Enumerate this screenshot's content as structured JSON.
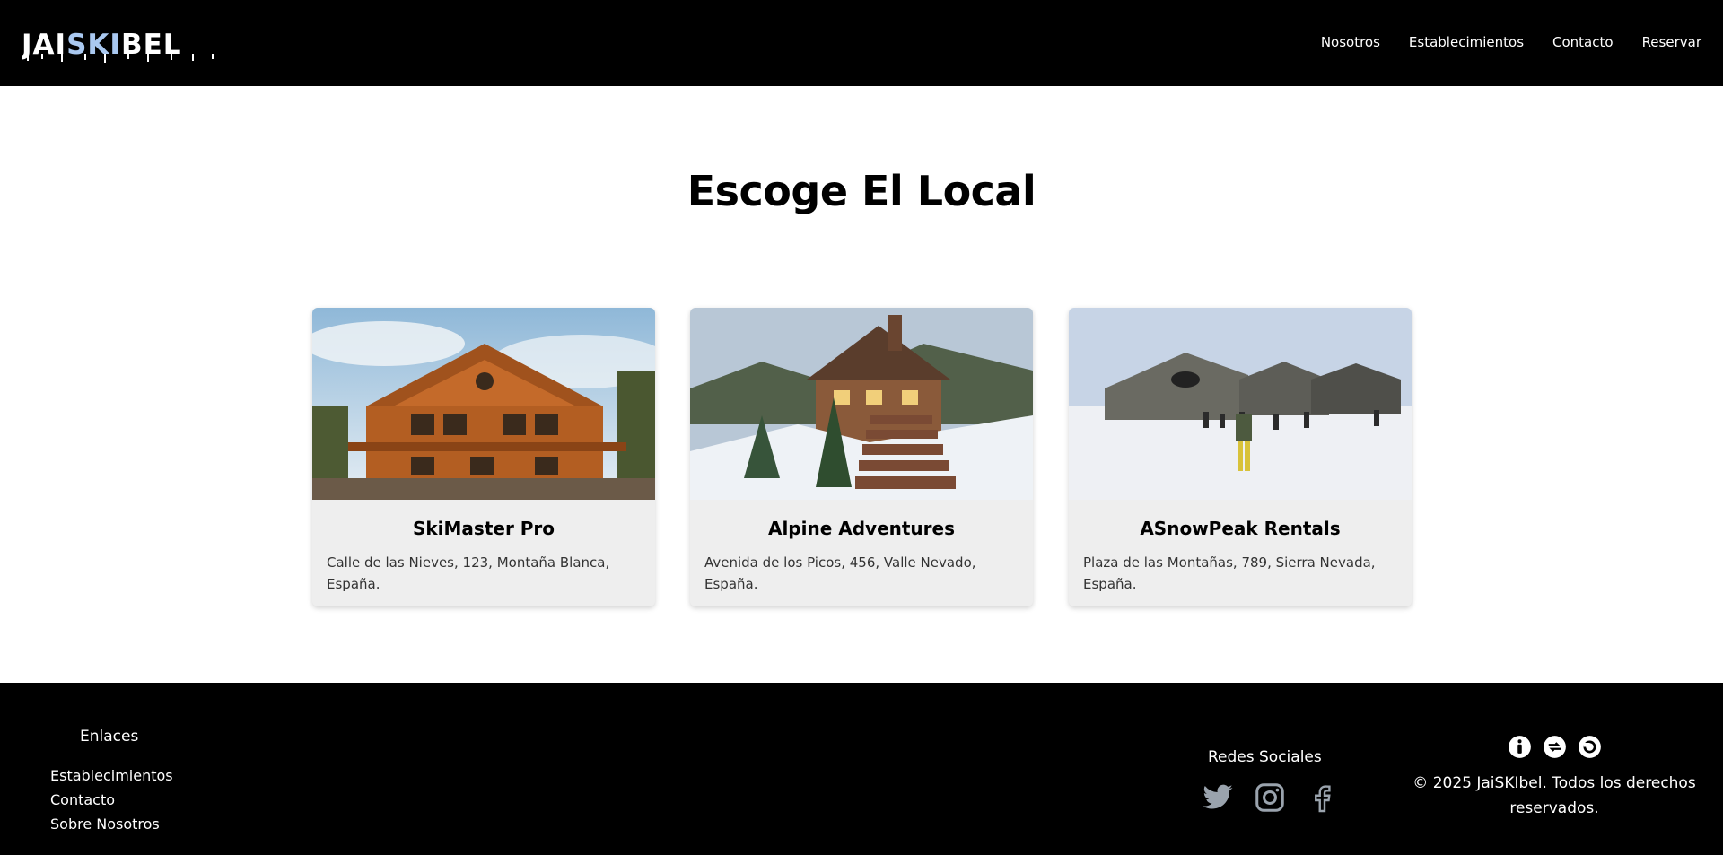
{
  "header": {
    "logo_text": "JAISKIBEL",
    "nav": [
      {
        "label": "Nosotros"
      },
      {
        "label": "Establecimientos"
      },
      {
        "label": "Contacto"
      },
      {
        "label": "Reservar"
      }
    ]
  },
  "main": {
    "title": "Escoge El Local",
    "cards": [
      {
        "name": "SkiMaster Pro",
        "address": "Calle de las Nieves, 123, Montaña Blanca, España."
      },
      {
        "name": "Alpine Adventures",
        "address": "Avenida de los Picos, 456, Valle Nevado, España."
      },
      {
        "name": "ASnowPeak Rentals",
        "address": "Plaza de las Montañas, 789, Sierra Nevada, España."
      }
    ]
  },
  "footer": {
    "links_title": "Enlaces",
    "links": [
      {
        "label": "Establecimientos"
      },
      {
        "label": "Contacto"
      },
      {
        "label": "Sobre Nosotros"
      }
    ],
    "social_title": "Redes Sociales",
    "social_icons": [
      "twitter-icon",
      "instagram-icon",
      "facebook-icon"
    ],
    "copyright": "© 2025 JaiSKIbel. Todos los derechos reservados."
  },
  "colors": {
    "header_bg": "#000000",
    "footer_bg": "#000000",
    "card_bg": "#eeeeee",
    "logo_accent": "#a9c8f0"
  }
}
